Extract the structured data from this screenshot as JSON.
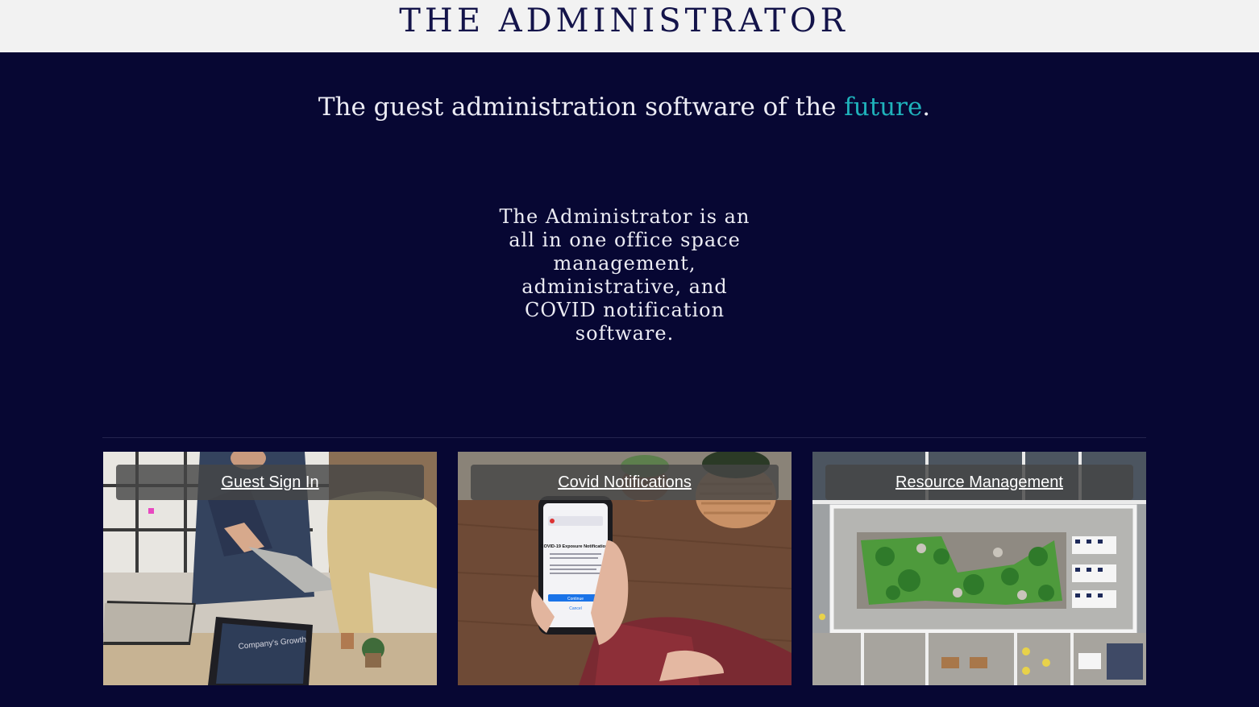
{
  "header": {
    "site_title": "THE ADMINISTRATOR"
  },
  "hero": {
    "tagline_prefix": "The guest administration software of the ",
    "tagline_accent": "future",
    "tagline_suffix": ".",
    "accent_color": "#1fb2bb",
    "description": "The Administrator is an all in one office space management, administrative, and COVID notification software."
  },
  "colors": {
    "background": "#070733",
    "header_background": "#f2f2f2",
    "title_color": "#14144a"
  },
  "cards": [
    {
      "label": "Guest Sign In",
      "image": "handshake-office-photo"
    },
    {
      "label": "Covid Notifications",
      "image": "phone-covid-exposure-photo"
    },
    {
      "label": "Resource Management",
      "image": "office-floor-plan-image"
    }
  ],
  "phone_screen": {
    "heading": "COVID-19 Exposure Notifications",
    "button": "Continue",
    "cancel": "Cancel"
  },
  "laptop_screen": {
    "heading": "Company's Growth"
  }
}
